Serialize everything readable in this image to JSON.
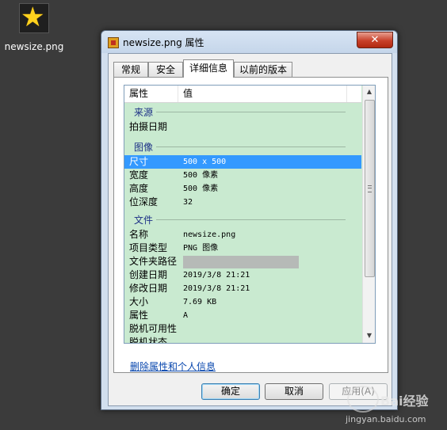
{
  "desktop_icon": {
    "label": "newsize.png"
  },
  "window": {
    "title": "newsize.png 属性",
    "close_glyph": "✕"
  },
  "tabs": [
    {
      "label": "常规",
      "active": false
    },
    {
      "label": "安全",
      "active": false
    },
    {
      "label": "详细信息",
      "active": true
    },
    {
      "label": "以前的版本",
      "active": false
    }
  ],
  "list": {
    "columns": [
      "属性",
      "值"
    ],
    "groups": {
      "source": "来源",
      "image": "图像",
      "file": "文件"
    },
    "rows": {
      "date_taken": {
        "key": "拍摄日期",
        "value": ""
      },
      "dimensions": {
        "key": "尺寸",
        "value": "500 x 500",
        "selected": true
      },
      "width": {
        "key": "宽度",
        "value": "500 像素"
      },
      "height": {
        "key": "高度",
        "value": "500 像素"
      },
      "bit_depth": {
        "key": "位深度",
        "value": "32"
      },
      "name": {
        "key": "名称",
        "value": "newsize.png"
      },
      "item_type": {
        "key": "项目类型",
        "value": "PNG 图像"
      },
      "folder_path": {
        "key": "文件夹路径",
        "value": ""
      },
      "created": {
        "key": "创建日期",
        "value": "2019/3/8 21:21"
      },
      "modified": {
        "key": "修改日期",
        "value": "2019/3/8 21:21"
      },
      "size": {
        "key": "大小",
        "value": "7.69 KB"
      },
      "attributes": {
        "key": "属性",
        "value": "A"
      },
      "offline_availability": {
        "key": "脱机可用性",
        "value": ""
      },
      "offline_status": {
        "key": "脱机状态",
        "value": ""
      }
    }
  },
  "remove_link": "删除属性和个人信息",
  "buttons": {
    "ok": "确定",
    "cancel": "取消",
    "apply": "应用(A)"
  },
  "watermark": {
    "main": "Bai经验",
    "sub": "jingyan.baidu.com"
  },
  "colors": {
    "list_bg": "#c9ead0",
    "selection": "#3399ff",
    "group_text": "#1e3287"
  }
}
